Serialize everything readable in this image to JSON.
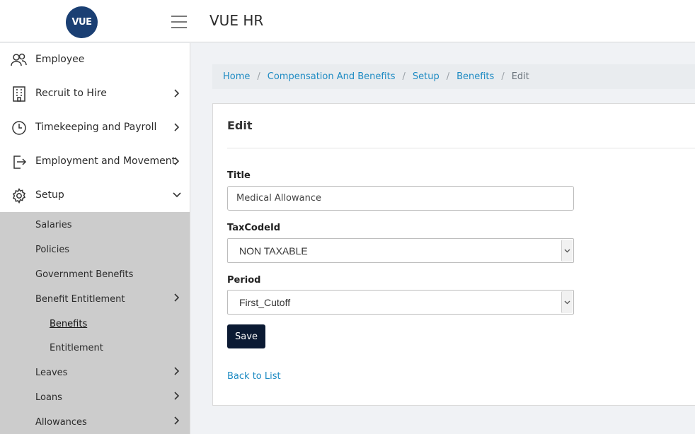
{
  "header": {
    "logo_text": "VUE",
    "app_title": "VUE HR",
    "menu_icon": "hamburger-icon"
  },
  "sidebar": {
    "items": [
      {
        "label": "Employee",
        "icon": "users-icon"
      },
      {
        "label": "Recruit to Hire",
        "icon": "building-icon"
      },
      {
        "label": "Timekeeping and Payroll",
        "icon": "clock-icon"
      },
      {
        "label": "Employment and Movement",
        "icon": "exit-door-icon"
      },
      {
        "label": "Setup",
        "icon": "gear-icon"
      }
    ],
    "setup_submenu": [
      {
        "label": "Salaries"
      },
      {
        "label": "Policies"
      },
      {
        "label": "Government Benefits"
      },
      {
        "label": "Benefit Entitlement"
      },
      {
        "label": "Benefits",
        "active": true
      },
      {
        "label": "Entitlement"
      },
      {
        "label": "Leaves"
      },
      {
        "label": "Loans"
      },
      {
        "label": "Allowances"
      }
    ]
  },
  "breadcrumb": {
    "items": [
      "Home",
      "Compensation And Benefits",
      "Setup",
      "Benefits"
    ],
    "current": "Edit"
  },
  "form": {
    "heading": "Edit",
    "title_label": "Title",
    "title_value": "Medical Allowance",
    "taxcode_label": "TaxCodeId",
    "taxcode_value": "NON TAXABLE",
    "period_label": "Period",
    "period_value": "First_Cutoff",
    "save_label": "Save",
    "back_label": "Back to List"
  },
  "colors": {
    "logo_bg": "#1a3f73",
    "link": "#1e8bc3",
    "save_button": "#0b1a33",
    "submenu_bg": "#cccccc"
  }
}
